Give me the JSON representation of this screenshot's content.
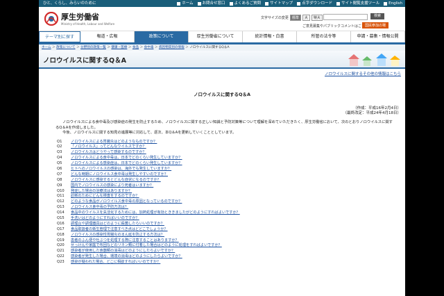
{
  "top_strip": {
    "tagline": "ひと、くらし、みらいのために",
    "links": [
      "ホーム",
      "お問合せ窓口",
      "よくあるご質問",
      "サイトマップ",
      "点字ダウンロード",
      "サイト閲覧支援ツール",
      "English"
    ]
  },
  "header": {
    "site_title": "厚生労働省",
    "site_subtitle": "Ministry of Health, Labour and Welfare",
    "font_size_label": "文字サイズの変更",
    "font_sizes": [
      "標準",
      "大",
      "特大"
    ],
    "search_button": "検索",
    "opinion_link": "ご意見募集やパブリックコメントはこちら",
    "participate_button": "国民参加の場"
  },
  "global_nav": [
    "テーマ別に探す",
    "報道・広報",
    "政策について",
    "厚生労働省について",
    "統計情報・白書",
    "所管の法令等",
    "申請・募集・情報公開"
  ],
  "breadcrumb": [
    "ホーム",
    "政策について",
    "分野別の政策一覧",
    "健康・医療",
    "食品",
    "食中毒",
    "病因物質別の情報"
  ],
  "breadcrumb_current": "ノロウイルスに関するQ＆A",
  "page_title": "ノロウイルスに関するQ＆A",
  "related_link": "ノロウイルスに関するその他の情報はこちら",
  "doc_title": "ノロウイルスに関するQ＆A",
  "dates": [
    "（作成：平成16年2月4日）",
    "（最終改定：平成24年4月18日）"
  ],
  "intro": [
    "ノロウイルスによる食中毒及び感染症の発生を防止するため、ノロウイルスに関する正しい知識と予防対策等について理解を深めていただきたく、厚生労働省において、次のとおりノロウイルスに関するQ＆Aを作成しました。",
    "今後、ノロウイルスに関する知見の進展等に対応して、逐次、本Q＆Aを更新していくこととしています。"
  ],
  "questions": [
    {
      "num": "Q1",
      "text": "ノロウイルスによる胃腸炎はどのようなものですか？"
    },
    {
      "num": "Q2",
      "text": "「ノロウイルス」ってどんなウイルスですか？"
    },
    {
      "num": "Q3",
      "text": "ノロウイルスはどうやって感染するのですか？"
    },
    {
      "num": "Q4",
      "text": "ノロウイルスによる食中毒は、日本でどのくらい発生していますか？"
    },
    {
      "num": "Q5",
      "text": "ノロウイルスによる感染症は、日本でどのくらい発生していますか？"
    },
    {
      "num": "Q6",
      "text": "ヒトへのノロウイルスの感染は、海外でも発生していますか？"
    },
    {
      "num": "Q7",
      "text": "どんな時期にノロウイルス食中毒は発生しやすいのですか？"
    },
    {
      "num": "Q8",
      "text": "ノロウイルスに感染するとどんな症状になるのですか？"
    },
    {
      "num": "Q9",
      "text": "国内でノロウイルスの感染により死者はいますか？"
    },
    {
      "num": "Q10",
      "text": "発症した場合の治療法はありますか？"
    },
    {
      "num": "Q11",
      "text": "診断のためにどんな検査をするのですか？"
    },
    {
      "num": "Q12",
      "text": "どのような食品がノロウイルス食中毒の原因となっているのですか？"
    },
    {
      "num": "Q13",
      "text": "ノロウイルス食中毒の予防方法は？"
    },
    {
      "num": "Q14",
      "text": "食品中のウイルスを失活化するためには、加熱処理が有効とききましたがどのようにすればよいですか？"
    },
    {
      "num": "Q15",
      "text": "手洗いはどのようにすればいいのですか？"
    },
    {
      "num": "Q16",
      "text": "調理台や調理器具はどのように殺菌したらいいのですか？"
    },
    {
      "num": "Q17",
      "text": "食品取扱者の衛生管理で注意すべき点はどどこでしょうか？"
    },
    {
      "num": "Q18",
      "text": "ノロウイルスの感染性胃腸炎のまん延を防止する方法は？"
    },
    {
      "num": "Q19",
      "text": "患者のふん便や吐ぶつを処理する際に注意することはありますか？"
    },
    {
      "num": "Q20",
      "text": "せっけんや家庭で布団などのリネン類に付着した場合はどのように処理をすればよいですか？"
    },
    {
      "num": "Q21",
      "text": "感染者が使用した食器類の消毒はどのようにしたらよいですか？"
    },
    {
      "num": "Q22",
      "text": "感染者が発生した場合、環境の消毒はどのようにしたらよいですか？"
    },
    {
      "num": "Q23",
      "text": "感染が疑われた場合、どこに相談すればいいのですか？"
    }
  ],
  "colors": {
    "nav_blue": "#2a6aa3",
    "link": "#1a4fa0",
    "top_strip": "#1a5e7a",
    "participate": "#d9540a"
  }
}
